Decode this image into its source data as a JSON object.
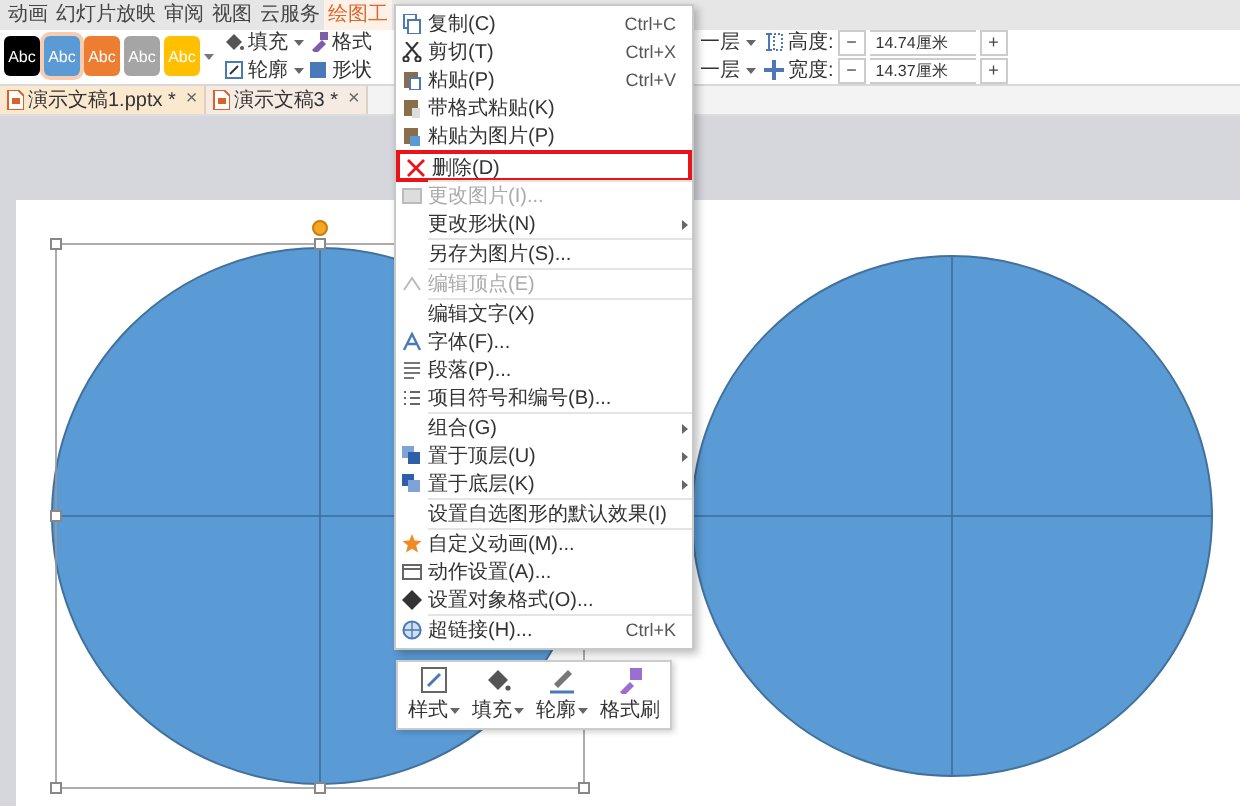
{
  "menu_tabs": [
    {
      "label": "动画",
      "selected": false
    },
    {
      "label": "幻灯片放映",
      "selected": false
    },
    {
      "label": "审阅",
      "selected": false
    },
    {
      "label": "视图",
      "selected": false
    },
    {
      "label": "云服务",
      "selected": false
    },
    {
      "label": "绘图工",
      "selected": true
    }
  ],
  "ribbon": {
    "styles": [
      {
        "label": "Abc",
        "color": "#000000",
        "selected": false
      },
      {
        "label": "Abc",
        "color": "#5b9bd5",
        "selected": true
      },
      {
        "label": "Abc",
        "color": "#ed7d31",
        "selected": false
      },
      {
        "label": "Abc",
        "color": "#a5a5a5",
        "selected": false
      },
      {
        "label": "Abc",
        "color": "#ffc000",
        "selected": false
      }
    ],
    "format_buttons": [
      {
        "label": "填充",
        "dropdown": true
      },
      {
        "label": "格式",
        "dropdown": false
      },
      {
        "label": "轮廓",
        "dropdown": true
      },
      {
        "label": "形状",
        "dropdown": false
      }
    ],
    "layer_buttons": [
      {
        "label": "一层",
        "dropdown": true
      },
      {
        "label": "一层",
        "dropdown": true
      }
    ],
    "size_fields": [
      {
        "label": "高度:",
        "decrement": "−",
        "value": "14.74厘米",
        "increment": "+"
      },
      {
        "label": "宽度:",
        "decrement": "−",
        "value": "14.37厘米",
        "increment": "+"
      }
    ]
  },
  "doc_tabs": [
    {
      "title": "演示文稿1.pptx *",
      "close": "×",
      "selected": true
    },
    {
      "title": "演示文稿3 *",
      "close": "×",
      "selected": false
    }
  ],
  "context_menu": {
    "groups": [
      [
        {
          "label": "复制(C)",
          "shortcut": "Ctrl+C",
          "selected": false,
          "disabled": false,
          "submenu": false
        },
        {
          "label": "剪切(T)",
          "shortcut": "Ctrl+X",
          "selected": false,
          "disabled": false,
          "submenu": false
        },
        {
          "label": "粘贴(P)",
          "shortcut": "Ctrl+V",
          "selected": false,
          "disabled": false,
          "submenu": false
        },
        {
          "label": "带格式粘贴(K)",
          "selected": false,
          "disabled": false,
          "submenu": false
        },
        {
          "label": "粘贴为图片(P)",
          "selected": false,
          "disabled": false,
          "submenu": false
        }
      ],
      [
        {
          "label": "删除(D)",
          "selected": true,
          "disabled": false,
          "submenu": false
        }
      ],
      [
        {
          "label": "更改图片(I)...",
          "selected": false,
          "disabled": true,
          "submenu": false
        },
        {
          "label": "更改形状(N)",
          "selected": false,
          "disabled": false,
          "submenu": true
        }
      ],
      [
        {
          "label": "另存为图片(S)...",
          "selected": false,
          "disabled": false,
          "submenu": false
        }
      ],
      [
        {
          "label": "编辑顶点(E)",
          "selected": false,
          "disabled": true,
          "submenu": false
        }
      ],
      [
        {
          "label": "编辑文字(X)",
          "selected": false,
          "disabled": false,
          "submenu": false
        },
        {
          "label": "字体(F)...",
          "selected": false,
          "disabled": false,
          "submenu": false
        },
        {
          "label": "段落(P)...",
          "selected": false,
          "disabled": false,
          "submenu": false
        },
        {
          "label": "项目符号和编号(B)...",
          "selected": false,
          "disabled": false,
          "submenu": false
        }
      ],
      [
        {
          "label": "组合(G)",
          "selected": false,
          "disabled": false,
          "submenu": true
        },
        {
          "label": "置于顶层(U)",
          "selected": false,
          "disabled": false,
          "submenu": true
        },
        {
          "label": "置于底层(K)",
          "selected": false,
          "disabled": false,
          "submenu": true
        }
      ],
      [
        {
          "label": "设置自选图形的默认效果(I)",
          "selected": false,
          "disabled": false,
          "submenu": false
        }
      ],
      [
        {
          "label": "自定义动画(M)...",
          "selected": false,
          "disabled": false,
          "submenu": false
        },
        {
          "label": "动作设置(A)...",
          "selected": false,
          "disabled": false,
          "submenu": false
        },
        {
          "label": "设置对象格式(O)...",
          "selected": false,
          "disabled": false,
          "submenu": false
        }
      ],
      [
        {
          "label": "超链接(H)...",
          "shortcut": "Ctrl+K",
          "selected": false,
          "disabled": false,
          "submenu": false
        }
      ]
    ]
  },
  "mini_toolbar": [
    {
      "label": "样式",
      "dropdown": true
    },
    {
      "label": "填充",
      "dropdown": true
    },
    {
      "label": "轮廓",
      "dropdown": true
    },
    {
      "label": "格式刷",
      "dropdown": false
    }
  ]
}
